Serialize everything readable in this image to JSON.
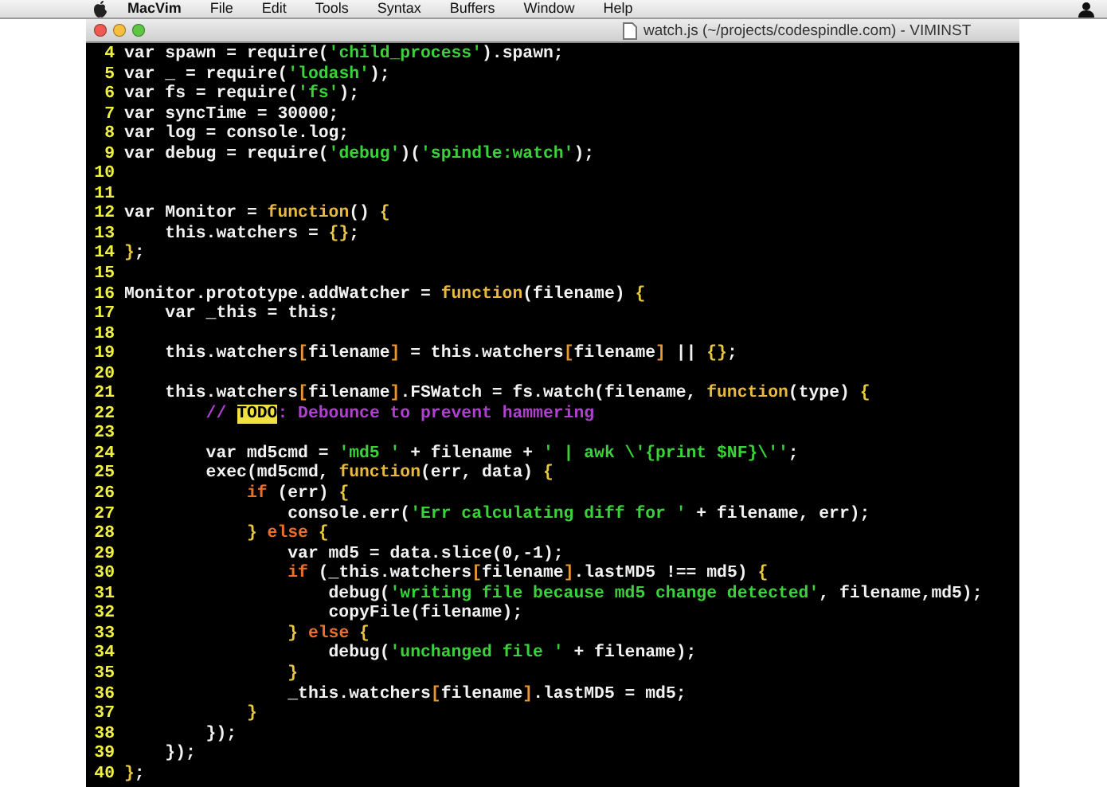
{
  "menu_bar": {
    "items": [
      "MacVim",
      "File",
      "Edit",
      "Tools",
      "Syntax",
      "Buffers",
      "Window",
      "Help"
    ]
  },
  "window": {
    "title": "watch.js (~/projects/codespindle.com) - VIMINST"
  },
  "editor": {
    "lines": [
      {
        "number": "4",
        "segments": [
          {
            "kind": "plain",
            "text": "var spawn = require("
          },
          {
            "kind": "string",
            "text": "'child_process'"
          },
          {
            "kind": "plain",
            "text": ").spawn;"
          }
        ]
      },
      {
        "number": "5",
        "segments": [
          {
            "kind": "plain",
            "text": "var _ = require("
          },
          {
            "kind": "string",
            "text": "'lodash'"
          },
          {
            "kind": "plain",
            "text": ");"
          }
        ]
      },
      {
        "number": "6",
        "segments": [
          {
            "kind": "plain",
            "text": "var fs = require("
          },
          {
            "kind": "string",
            "text": "'fs'"
          },
          {
            "kind": "plain",
            "text": ");"
          }
        ]
      },
      {
        "number": "7",
        "segments": [
          {
            "kind": "plain",
            "text": "var syncTime = 30000;"
          }
        ]
      },
      {
        "number": "8",
        "segments": [
          {
            "kind": "plain",
            "text": "var log = console.log;"
          }
        ]
      },
      {
        "number": "9",
        "segments": [
          {
            "kind": "plain",
            "text": "var debug = require("
          },
          {
            "kind": "string",
            "text": "'debug'"
          },
          {
            "kind": "plain",
            "text": ")("
          },
          {
            "kind": "string",
            "text": "'spindle:watch'"
          },
          {
            "kind": "plain",
            "text": ");"
          }
        ]
      },
      {
        "number": "10"
      },
      {
        "number": "11"
      },
      {
        "number": "12",
        "segments": [
          {
            "kind": "plain",
            "text": "var Monitor = "
          },
          {
            "kind": "function",
            "text": "function"
          },
          {
            "kind": "plain",
            "text": "() "
          },
          {
            "kind": "brace",
            "text": "{"
          }
        ]
      },
      {
        "number": "13",
        "segments": [
          {
            "kind": "plain",
            "text": "    this.watchers = "
          },
          {
            "kind": "brace",
            "text": "{}"
          },
          {
            "kind": "plain",
            "text": ";"
          }
        ]
      },
      {
        "number": "14",
        "segments": [
          {
            "kind": "brace",
            "text": "}"
          },
          {
            "kind": "plain",
            "text": ";"
          }
        ]
      },
      {
        "number": "15"
      },
      {
        "number": "16",
        "segments": [
          {
            "kind": "plain",
            "text": "Monitor.prototype.addWatcher = "
          },
          {
            "kind": "function",
            "text": "function"
          },
          {
            "kind": "plain",
            "text": "(filename) "
          },
          {
            "kind": "brace",
            "text": "{"
          }
        ]
      },
      {
        "number": "17",
        "segments": [
          {
            "kind": "plain",
            "text": "    var _this = this;"
          }
        ]
      },
      {
        "number": "18"
      },
      {
        "number": "19",
        "segments": [
          {
            "kind": "plain",
            "text": "    this.watchers"
          },
          {
            "kind": "bracket",
            "text": "["
          },
          {
            "kind": "plain",
            "text": "filename"
          },
          {
            "kind": "bracket",
            "text": "]"
          },
          {
            "kind": "plain",
            "text": " = this.watchers"
          },
          {
            "kind": "bracket",
            "text": "["
          },
          {
            "kind": "plain",
            "text": "filename"
          },
          {
            "kind": "bracket",
            "text": "]"
          },
          {
            "kind": "plain",
            "text": " || "
          },
          {
            "kind": "brace",
            "text": "{}"
          },
          {
            "kind": "plain",
            "text": ";"
          }
        ]
      },
      {
        "number": "20"
      },
      {
        "number": "21",
        "segments": [
          {
            "kind": "plain",
            "text": "    this.watchers"
          },
          {
            "kind": "bracket",
            "text": "["
          },
          {
            "kind": "plain",
            "text": "filename"
          },
          {
            "kind": "bracket",
            "text": "]"
          },
          {
            "kind": "plain",
            "text": ".FSWatch = fs.watch(filename, "
          },
          {
            "kind": "function",
            "text": "function"
          },
          {
            "kind": "plain",
            "text": "(type) "
          },
          {
            "kind": "brace",
            "text": "{"
          }
        ]
      },
      {
        "number": "22",
        "segments": [
          {
            "kind": "comment",
            "text": "        // "
          },
          {
            "kind": "todo",
            "text": "TODO"
          },
          {
            "kind": "comment",
            "text": ": Debounce to prevent hammering"
          }
        ]
      },
      {
        "number": "23"
      },
      {
        "number": "24",
        "segments": [
          {
            "kind": "plain",
            "text": "        var md5cmd = "
          },
          {
            "kind": "string",
            "text": "'md5 '"
          },
          {
            "kind": "plain",
            "text": " + filename + "
          },
          {
            "kind": "string",
            "text": "' | awk \\'{print $NF}\\''"
          },
          {
            "kind": "plain",
            "text": ";"
          }
        ]
      },
      {
        "number": "25",
        "segments": [
          {
            "kind": "plain",
            "text": "        exec(md5cmd, "
          },
          {
            "kind": "function",
            "text": "function"
          },
          {
            "kind": "plain",
            "text": "(err, data) "
          },
          {
            "kind": "brace",
            "text": "{"
          }
        ]
      },
      {
        "number": "26",
        "segments": [
          {
            "kind": "conditional",
            "text": "            if"
          },
          {
            "kind": "plain",
            "text": " (err) "
          },
          {
            "kind": "brace",
            "text": "{"
          }
        ]
      },
      {
        "number": "27",
        "segments": [
          {
            "kind": "plain",
            "text": "                console.err("
          },
          {
            "kind": "string",
            "text": "'Err calculating diff for '"
          },
          {
            "kind": "plain",
            "text": " + filename, err);"
          }
        ]
      },
      {
        "number": "28",
        "segments": [
          {
            "kind": "brace",
            "text": "            } "
          },
          {
            "kind": "conditional",
            "text": "else "
          },
          {
            "kind": "brace",
            "text": "{"
          }
        ]
      },
      {
        "number": "29",
        "segments": [
          {
            "kind": "plain",
            "text": "                var md5 = data.slice(0,-1);"
          }
        ]
      },
      {
        "number": "30",
        "segments": [
          {
            "kind": "conditional",
            "text": "                if"
          },
          {
            "kind": "plain",
            "text": " (_this.watchers"
          },
          {
            "kind": "bracket",
            "text": "["
          },
          {
            "kind": "plain",
            "text": "filename"
          },
          {
            "kind": "bracket",
            "text": "]"
          },
          {
            "kind": "plain",
            "text": ".lastMD5 !== md5) "
          },
          {
            "kind": "brace",
            "text": "{"
          }
        ]
      },
      {
        "number": "31",
        "segments": [
          {
            "kind": "plain",
            "text": "                    debug("
          },
          {
            "kind": "string",
            "text": "'writing file because md5 change detected'"
          },
          {
            "kind": "plain",
            "text": ", filename,md5);"
          }
        ]
      },
      {
        "number": "32",
        "segments": [
          {
            "kind": "plain",
            "text": "                    copyFile(filename);"
          }
        ]
      },
      {
        "number": "33",
        "segments": [
          {
            "kind": "brace",
            "text": "                } "
          },
          {
            "kind": "conditional",
            "text": "else "
          },
          {
            "kind": "brace",
            "text": "{"
          }
        ]
      },
      {
        "number": "34",
        "segments": [
          {
            "kind": "plain",
            "text": "                    debug("
          },
          {
            "kind": "string",
            "text": "'unchanged file '"
          },
          {
            "kind": "plain",
            "text": " + filename);"
          }
        ]
      },
      {
        "number": "35",
        "segments": [
          {
            "kind": "brace",
            "text": "                }"
          }
        ]
      },
      {
        "number": "36",
        "segments": [
          {
            "kind": "plain",
            "text": "                _this.watchers"
          },
          {
            "kind": "bracket",
            "text": "["
          },
          {
            "kind": "plain",
            "text": "filename"
          },
          {
            "kind": "bracket",
            "text": "]"
          },
          {
            "kind": "plain",
            "text": ".lastMD5 = md5;"
          }
        ]
      },
      {
        "number": "37",
        "segments": [
          {
            "kind": "brace",
            "text": "            }"
          }
        ]
      },
      {
        "number": "38",
        "segments": [
          {
            "kind": "plain",
            "text": "        });"
          }
        ]
      },
      {
        "number": "39",
        "segments": [
          {
            "kind": "plain",
            "text": "    });"
          }
        ]
      },
      {
        "number": "40",
        "segments": [
          {
            "kind": "brace",
            "text": "}"
          },
          {
            "kind": "plain",
            "text": ";"
          }
        ]
      }
    ]
  }
}
